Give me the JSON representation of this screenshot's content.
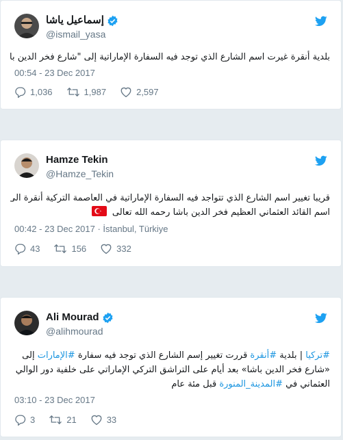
{
  "colors": {
    "background": "#e6ecf0",
    "card": "#ffffff",
    "border": "#e1e8ed",
    "muted": "#657786",
    "twitter_blue": "#1da1f2",
    "link": "#1b95e0",
    "turkish_red": "#e30a17"
  },
  "tweets": [
    {
      "name": "إسماعيل ياشا",
      "handle": "@ismail_yasa",
      "verified": true,
      "text_lines": [
        "بلدية أنقرة غيرت اسم الشارع الذي توجد فيه السفارة الإماراتية إلى \"شارع فخر الدين باشا\""
      ],
      "timestamp": "00:54 - 23 Dec 2017",
      "replies": "1,036",
      "retweets": "1,987",
      "likes": "2,597"
    },
    {
      "name": "Hamze Tekin",
      "handle": "@Hamze_Tekin",
      "verified": false,
      "text_lines": [
        "قريبا تغيير اسم الشارع الذي تتواجد فيه السفارة الإماراتية في العاصمة التركية أنقرة الى",
        "اسم القائد العثماني العظيم فخر الدين باشا رحمه الله تعالى"
      ],
      "flag_emoji": "turkey-flag",
      "timestamp": "00:42 - 23 Dec 2017",
      "location": "İstanbul, Türkiye",
      "replies": "43",
      "retweets": "156",
      "likes": "332"
    },
    {
      "name": "Ali Mourad",
      "handle": "@alihmourad",
      "verified": true,
      "line1": {
        "hashtag1": "#تركيا",
        "sep": " | بلدية ",
        "hashtag2": "#أنقرة",
        "mid": " قررت تغيير إسم الشارع الذي توجد فيه سفارة ",
        "hashtag3": "#الإمارات",
        "end": " إلى"
      },
      "line2": "«شارع فخر الدين باشا» بعد أيام على التراشق التركي الإماراتي على خلفية دور الوالي",
      "line3": {
        "start": "العثماني في ",
        "hashtag": "#المدينة_المنورة",
        "end": " قبل مئة عام"
      },
      "timestamp": "03:10 - 23 Dec 2017",
      "replies": "3",
      "retweets": "21",
      "likes": "33"
    }
  ]
}
